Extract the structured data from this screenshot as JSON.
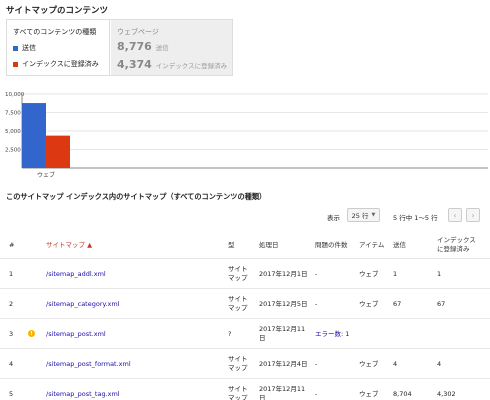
{
  "section_title": "サイトマップのコンテンツ",
  "content_types": {
    "all_label": "すべてのコンテンツの種類",
    "legend": [
      {
        "label": "送信",
        "color": "#3366cc"
      },
      {
        "label": "インデックスに登録済み",
        "color": "#dc3912"
      }
    ],
    "web_label": "ウェブページ",
    "stats": [
      {
        "value": "8,776",
        "label": "送信"
      },
      {
        "value": "4,374",
        "label": "インデックスに登録済み"
      }
    ]
  },
  "chart_data": {
    "type": "bar",
    "categories": [
      "ウェブ"
    ],
    "series": [
      {
        "name": "送信",
        "values": [
          8776
        ],
        "color": "#3366cc"
      },
      {
        "name": "インデックスに登録済み",
        "values": [
          4374
        ],
        "color": "#dc3912"
      }
    ],
    "ylim": [
      0,
      10000
    ],
    "yticks": [
      "10,000",
      "7,500",
      "5,000",
      "2,500"
    ],
    "ytick_values": [
      10000,
      7500,
      5000,
      2500
    ],
    "legend": "none",
    "grid": true
  },
  "table_title": "このサイトマップ インデックス内のサイトマップ（すべてのコンテンツの種類）",
  "controls": {
    "show_label": "表示",
    "rows_value": "25 行",
    "range_label": "5 行中 1〜5 行",
    "prev_icon": "‹",
    "next_icon": "›"
  },
  "table": {
    "headers": {
      "num": "#",
      "sitemap": "サイトマップ ▲",
      "type": "型",
      "processed": "処理日",
      "issues": "問題の件数",
      "items": "アイテム",
      "submitted": "送信",
      "indexed_line1": "インデックス",
      "indexed_line2": "に登録済み"
    },
    "rows": [
      {
        "num": "1",
        "warn": false,
        "sitemap": "/sitemap_addl.xml",
        "type_l1": "サイト",
        "type_l2": "マップ",
        "date_l1": "2017年12月1日",
        "date_l2": "",
        "issues": "-",
        "items": "ウェブ",
        "submitted": "1",
        "indexed": "1"
      },
      {
        "num": "2",
        "warn": false,
        "sitemap": "/sitemap_category.xml",
        "type_l1": "サイト",
        "type_l2": "マップ",
        "date_l1": "2017年12月5日",
        "date_l2": "",
        "issues": "-",
        "items": "ウェブ",
        "submitted": "67",
        "indexed": "67"
      },
      {
        "num": "3",
        "warn": true,
        "sitemap": "/sitemap_post.xml",
        "type_l1": "?",
        "type_l2": "",
        "date_l1": "2017年12月11",
        "date_l2": "日",
        "issues": "エラー数: 1",
        "items": "",
        "submitted": "",
        "indexed": ""
      },
      {
        "num": "4",
        "warn": false,
        "sitemap": "/sitemap_post_format.xml",
        "type_l1": "サイト",
        "type_l2": "マップ",
        "date_l1": "2017年12月4日",
        "date_l2": "",
        "issues": "-",
        "items": "ウェブ",
        "submitted": "4",
        "indexed": "4"
      },
      {
        "num": "5",
        "warn": false,
        "sitemap": "/sitemap_post_tag.xml",
        "type_l1": "サイト",
        "type_l2": "マップ",
        "date_l1": "2017年12月11",
        "date_l2": "日",
        "issues": "-",
        "items": "ウェブ",
        "submitted": "8,704",
        "indexed": "4,302"
      }
    ]
  }
}
